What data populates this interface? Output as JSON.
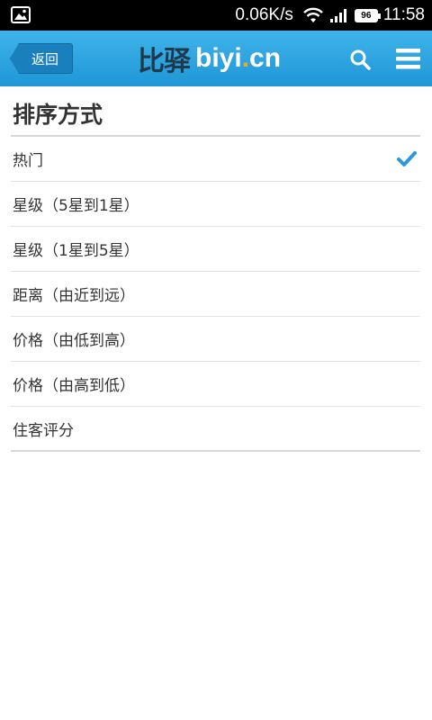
{
  "status_bar": {
    "network_speed": "0.06K/s",
    "battery_level": "96",
    "time": "11:58"
  },
  "header": {
    "back_label": "返回",
    "logo_cn": "比驿",
    "logo_en_before_dot": "biyi",
    "logo_dot": ".",
    "logo_en_after_dot": "cn",
    "search_icon": "search-icon",
    "menu_icon": "hamburger-menu-icon",
    "colors": {
      "header": "#1f96d6",
      "back_button": "#1a7fbd",
      "logo_dot": "#f2a91d"
    }
  },
  "page": {
    "title": "排序方式"
  },
  "sort_options": [
    {
      "label": "热门",
      "selected": true
    },
    {
      "label": "星级（5星到1星）",
      "selected": false
    },
    {
      "label": "星级（1星到5星）",
      "selected": false
    },
    {
      "label": "距离（由近到远）",
      "selected": false
    },
    {
      "label": "价格（由低到高）",
      "selected": false
    },
    {
      "label": "价格（由高到低）",
      "selected": false
    },
    {
      "label": "住客评分",
      "selected": false
    }
  ],
  "selected_check_color": "#2a9ad8"
}
